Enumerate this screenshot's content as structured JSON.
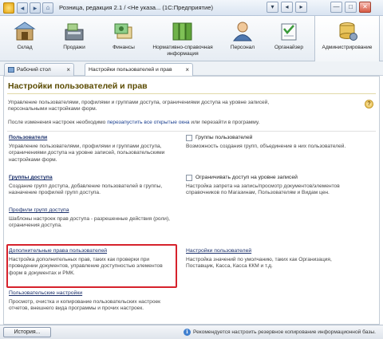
{
  "window": {
    "title": "Розница, редакция 2.1 / <Не указа... (1С:Предприятие)",
    "buttons": [
      "▾",
      "◂",
      "▸",
      "—",
      "□",
      "✕"
    ]
  },
  "sections": [
    {
      "label": "Склад",
      "icon": "warehouse-icon"
    },
    {
      "label": "Продажи",
      "icon": "cash-register-icon"
    },
    {
      "label": "Финансы",
      "icon": "finance-icon"
    },
    {
      "label": "Нормативно-справочная информация",
      "icon": "binders-icon"
    },
    {
      "label": "Персонал",
      "icon": "person-icon"
    },
    {
      "label": "Органайзер",
      "icon": "organizer-icon"
    },
    {
      "label": "Администрирование",
      "icon": "admin-icon"
    }
  ],
  "tabs": [
    {
      "label": "Рабочий стол",
      "icon": "desktop-icon",
      "close": "×"
    },
    {
      "label": "Настройки пользователей и прав",
      "close": "×"
    }
  ],
  "page": {
    "title": "Настройки пользователей и прав",
    "description": "Управление пользователями, профилями и группами доступа, ограничениями доступа на уровне записей, персональными настройками форм.",
    "help": "?",
    "note_before": "После изменения настроек необходимо ",
    "note_link": "перезапустить все открытые окна",
    "note_after": " или перезайти в программу."
  },
  "left_items": [
    {
      "link": "Пользователи",
      "desc": "Управление пользователями, профилями и группами доступа, ограничениями доступа на уровне записей, пользовательскими настройками форм."
    },
    {
      "link": "Группы доступа",
      "desc": "Создание групп доступа, добавление пользователей в группы, назначение профилей групп доступа."
    },
    {
      "link": "Профили групп доступа",
      "desc": "Шаблоны настроек прав доступа - разрешенные действия (роли), ограничения доступа."
    },
    {
      "link": "Дополнительные права пользователей",
      "desc": "Настройка дополнительных прав, таких как проверки при проведении документов, управление доступностью элементов форм в документах и РМК."
    },
    {
      "link": "Пользовательские настройки",
      "desc": "Просмотр, очистка и копирование пользовательских настроек отчетов, внешнего вида программы и прочих настроек."
    }
  ],
  "right_items": [
    {
      "checkbox": "Группы пользователей",
      "checked": false,
      "desc": "Возможность создания групп, объединение в них пользователей."
    },
    {
      "checkbox": "Ограничивать доступ на уровне записей",
      "checked": false,
      "desc": "Настройка запрета на запись/просмотр документов/элементов справочников по Магазинам, Пользователям и Видам цен."
    },
    {
      "link": "Настройки пользователей",
      "desc": "Настройка значений по умолчанию, таких как Организация, Поставщик, Касса, Касса ККМ и т.д."
    }
  ],
  "statusbar": {
    "history_button": "История...",
    "info_icon": "i",
    "message": "Рекомендуется настроить резервное копирование информационной базы."
  },
  "colors": {
    "title": "#5a4a00",
    "link": "#1a2f6a",
    "highlight": "#d6222c"
  }
}
